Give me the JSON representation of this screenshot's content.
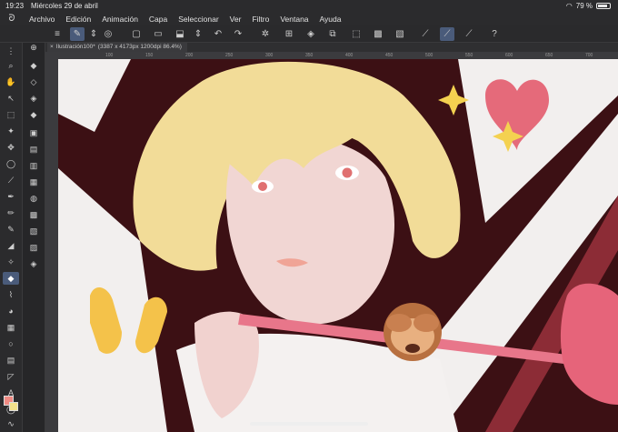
{
  "status": {
    "time": "19:23",
    "date": "Miércoles 29 de abril",
    "battery": "79 %",
    "battery_level": 0.79
  },
  "menu": {
    "items": [
      "Archivo",
      "Edición",
      "Animación",
      "Capa",
      "Seleccionar",
      "Ver",
      "Filtro",
      "Ventana",
      "Ayuda"
    ]
  },
  "document": {
    "name": "Ilustración100*",
    "info": "(3387 x 4173px 1200dpi 86.4%)"
  },
  "ruler": {
    "ticks": [
      "100",
      "150",
      "200",
      "250",
      "300",
      "350",
      "400",
      "450",
      "500",
      "550",
      "600",
      "650",
      "700"
    ]
  },
  "colors": {
    "main": "#f08b84",
    "sub": "#f2e08a",
    "accent": "#4a5b7a"
  },
  "icons": {
    "commands": [
      "menu-icon",
      "canvas-icon",
      "toggle-icon",
      "new-icon",
      "open-icon",
      "save-icon",
      "export-icon",
      "undo-icon",
      "redo-icon",
      "loading-icon",
      "clear-icon",
      "fill-icon",
      "transform-icon",
      "lasso-icon",
      "deselect-icon",
      "invert-icon",
      "ruler-icon",
      "pen-icon",
      "stroke-icon",
      "help-icon"
    ]
  }
}
